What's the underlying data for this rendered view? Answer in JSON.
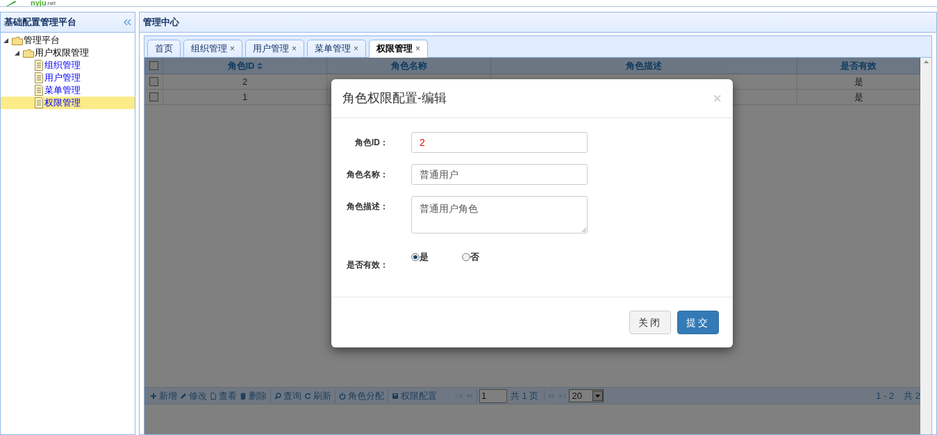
{
  "header": {
    "logo": "nyju",
    "logo_suffix": ".net"
  },
  "sidebar": {
    "title": "基础配置管理平台",
    "tree": [
      {
        "label": "管理平台",
        "expanded": true,
        "children": [
          {
            "label": "用户权限管理",
            "expanded": true,
            "children": [
              {
                "label": "组织管理",
                "selected": false
              },
              {
                "label": "用户管理",
                "selected": false
              },
              {
                "label": "菜单管理",
                "selected": false
              },
              {
                "label": "权限管理",
                "selected": true
              }
            ]
          }
        ]
      }
    ]
  },
  "main": {
    "title": "管理中心",
    "tabs": [
      {
        "label": "首页",
        "selected": false
      },
      {
        "label": "组织管理",
        "close": "×",
        "selected": false
      },
      {
        "label": "用户管理",
        "close": "×",
        "selected": false
      },
      {
        "label": "菜单管理",
        "close": "×",
        "selected": false
      },
      {
        "label": "权限管理",
        "close": "×",
        "selected": true
      }
    ]
  },
  "grid": {
    "columns": [
      "角色ID",
      "角色名称",
      "角色描述",
      "是否有效"
    ],
    "header_checked": false,
    "rows": [
      {
        "checked": false,
        "id": "2",
        "valid": "是"
      },
      {
        "checked": false,
        "id": "1",
        "valid": "是"
      }
    ]
  },
  "toolbar": {
    "button_groups": [
      [
        "新增",
        "修改",
        "查看",
        "删除"
      ],
      [
        "查询",
        "刷新"
      ],
      [
        "角色分配"
      ],
      [
        "权限配置"
      ]
    ]
  },
  "pager": {
    "page": "1",
    "total_pages": "共 1 页",
    "page_size": "20",
    "range": "1 - 2",
    "total": "共 2"
  },
  "dialog": {
    "title": "角色权限配置-编辑",
    "close": "×",
    "fields": [
      {
        "kind": "input",
        "label": "角色ID：",
        "value": "2",
        "highlight": true
      },
      {
        "kind": "input",
        "label": "角色名称：",
        "value": "普通用户",
        "highlight": false
      },
      {
        "kind": "textarea",
        "label": "角色描述：",
        "value": "普通用户角色"
      },
      {
        "kind": "radio",
        "label": "是否有效：",
        "options": [
          {
            "label": "是",
            "selected": true
          },
          {
            "label": "否",
            "selected": false
          }
        ]
      }
    ],
    "buttons": [
      {
        "label": "关闭",
        "kind": "default"
      },
      {
        "label": "提交",
        "kind": "primary"
      }
    ]
  }
}
